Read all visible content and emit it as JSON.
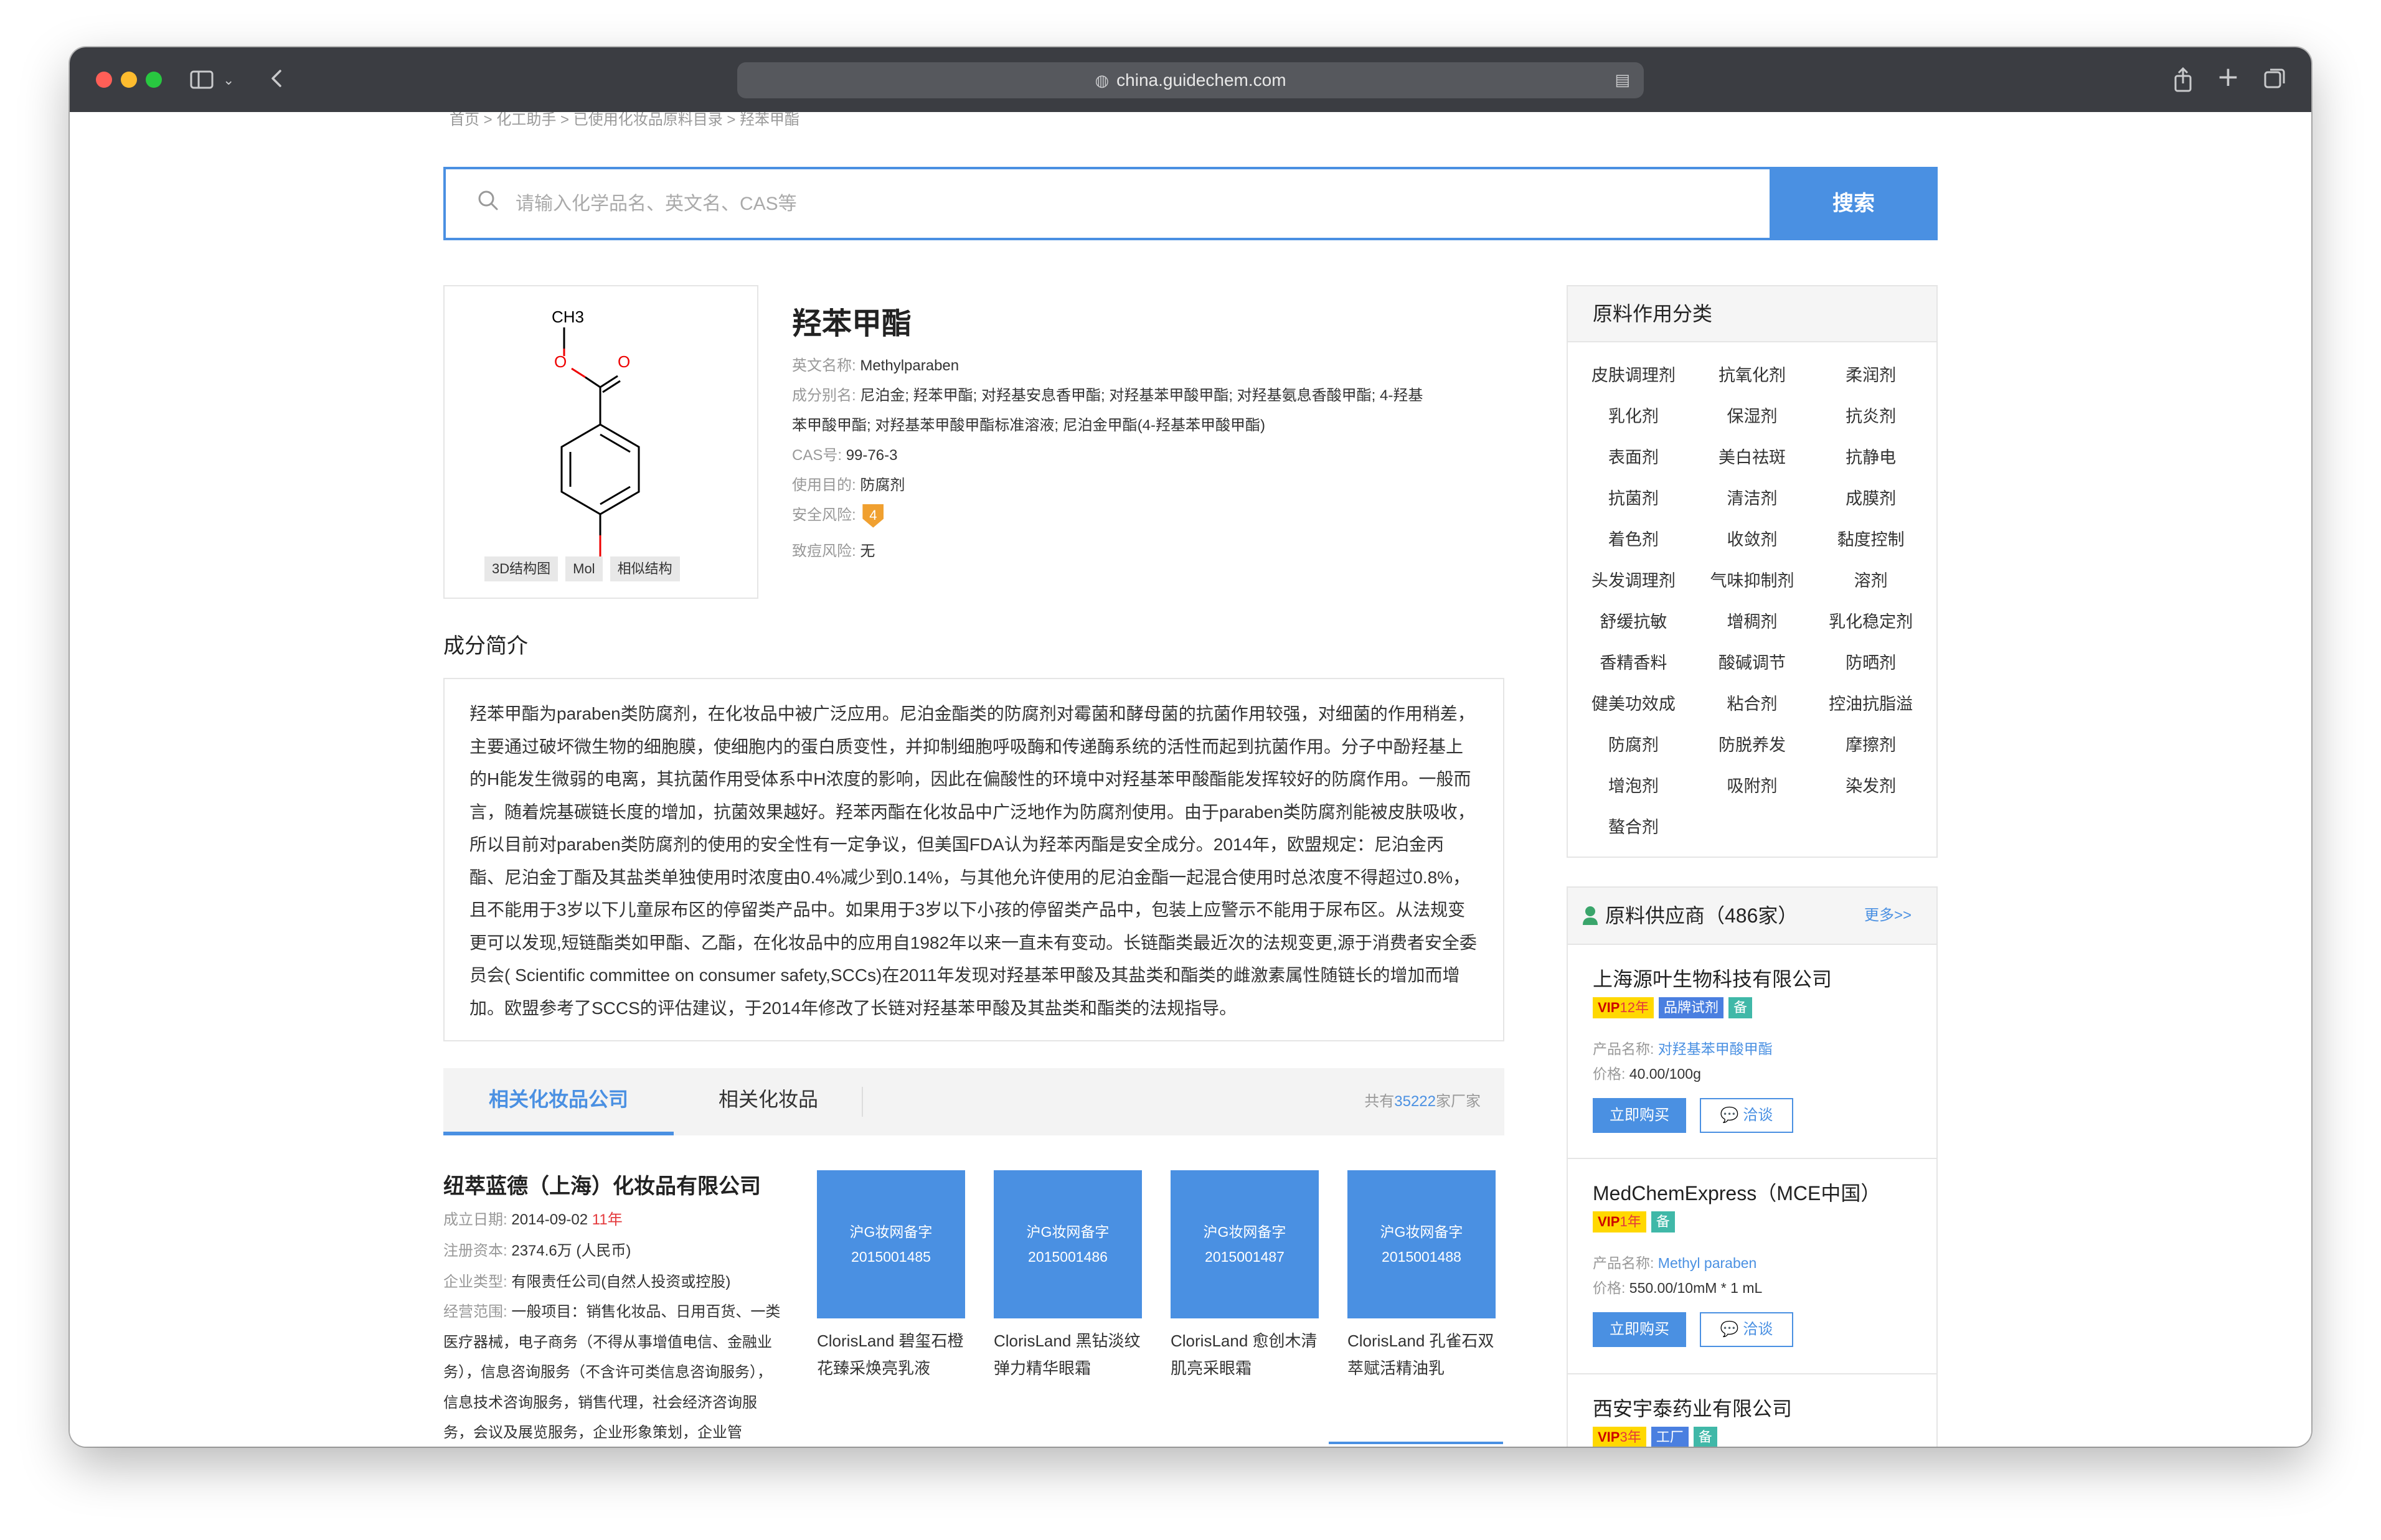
{
  "browser": {
    "url": "china.guidechem.com"
  },
  "breadcrumb": "首页 >   化工助手 >   已使用化妆品原料目录 > 羟苯甲酯",
  "search": {
    "placeholder": "请输入化学品名、英文名、CAS等",
    "button": "搜索"
  },
  "structure": {
    "methyl_label": "CH3",
    "tabs": [
      "3D结构图",
      "Mol",
      "相似结构"
    ]
  },
  "compound": {
    "title": "羟苯甲酯",
    "en_label": "英文名称:",
    "en_value": "Methylparaben",
    "alias_label": "成分别名:",
    "alias_line1": "尼泊金; 羟苯甲酯; 对羟基安息香甲酯; 对羟基苯甲酸甲酯; 对羟基氨息香酸甲酯; 4-羟基",
    "alias_line2": "苯甲酸甲酯; 对羟基苯甲酸甲酯标准溶液; 尼泊金甲酯(4-羟基苯甲酸甲酯)",
    "cas_label": "CAS号:",
    "cas_value": "99-76-3",
    "purpose_label": "使用目的:",
    "purpose_value": "防腐剂",
    "risk_label": "安全风险:",
    "risk_value": "4",
    "acne_label": "致痘风险:",
    "acne_value": "无"
  },
  "intro": {
    "title": "成分简介",
    "text": "羟苯甲酯为paraben类防腐剂，在化妆品中被广泛应用。尼泊金酯类的防腐剂对霉菌和酵母菌的抗菌作用较强，对细菌的作用稍差，主要通过破坏微生物的细胞膜，使细胞内的蛋白质变性，并抑制细胞呼吸酶和传递酶系统的活性而起到抗菌作用。分子中酚羟基上的H能发生微弱的电离，其抗菌作用受体系中H浓度的影响，因此在偏酸性的环境中对羟基苯甲酸酯能发挥较好的防腐作用。一般而言，随着烷基碳链长度的增加，抗菌效果越好。羟苯丙酯在化妆品中广泛地作为防腐剂使用。由于paraben类防腐剂能被皮肤吸收，所以目前对paraben类防腐剂的使用的安全性有一定争议，但美国FDA认为羟苯丙酯是安全成分。2014年，欧盟规定：尼泊金丙酯、尼泊金丁酯及其盐类单独使用时浓度由0.4%减少到0.14%，与其他允许使用的尼泊金酯一起混合使用时总浓度不得超过0.8%，且不能用于3岁以下儿童尿布区的停留类产品中。如果用于3岁以下小孩的停留类产品中，包装上应警示不能用于尿布区。从法规变更可以发现,短链酯类如甲酯、乙酯，在化妆品中的应用自1982年以来一直未有变动。长链酯类最近次的法规变更,源于消费者安全委员会( Scientific committee on consumer safety,SCCs)在2011年发现对羟基苯甲酸及其盐类和酯类的雌激素属性随链长的增加而增加。欧盟参考了SCCS的评估建议，于2014年修改了长链对羟基苯甲酸及其盐类和酯类的法规指导。"
  },
  "tabs": {
    "active": "相关化妆品公司",
    "other": "相关化妆品",
    "count_prefix": "共有",
    "count_num": "35222",
    "count_suffix": "家厂家"
  },
  "company": {
    "name": "纽萃蓝德（上海）化妆品有限公司",
    "founded_label": "成立日期:",
    "founded_value": "2014-09-02",
    "founded_years": "11年",
    "capital_label": "注册资本:",
    "capital_value": "2374.6万 (人民币)",
    "type_label": "企业类型:",
    "type_value": "有限责任公司(自然人投资或控股)",
    "scope_label": "经营范围:",
    "scope_value": "一般项目：销售化妆品、日用百货、一类医疗器械，电子商务（不得从事增值电信、金融业务），信息咨询服务（不含许可类信息咨询服务），信息技术咨询服务，销售代理，社会经济咨询服务，会议及展览服务，企业形象策划，企业管"
  },
  "products": [
    {
      "img_line1": "沪G妆网备字",
      "img_line2": "2015001485",
      "name": "ClorisLand 碧玺石橙花臻采焕亮乳液"
    },
    {
      "img_line1": "沪G妆网备字",
      "img_line2": "2015001486",
      "name": "ClorisLand 黑钻淡纹弹力精华眼霜"
    },
    {
      "img_line1": "沪G妆网备字",
      "img_line2": "2015001487",
      "name": "ClorisLand 愈创木清肌亮采眼霜"
    },
    {
      "img_line1": "沪G妆网备字",
      "img_line2": "2015001488",
      "name": "ClorisLand 孔雀石双萃赋活精油乳"
    }
  ],
  "categories": {
    "title": "原料作用分类",
    "items": [
      "皮肤调理剂",
      "抗氧化剂",
      "柔润剂",
      "乳化剂",
      "保湿剂",
      "抗炎剂",
      "表面剂",
      "美白祛斑",
      "抗静电",
      "抗菌剂",
      "清洁剂",
      "成膜剂",
      "着色剂",
      "收敛剂",
      "黏度控制",
      "头发调理剂",
      "气味抑制剂",
      "溶剂",
      "舒缓抗敏",
      "增稠剂",
      "乳化稳定剂",
      "香精香料",
      "酸碱调节",
      "防晒剂",
      "健美功效成",
      "粘合剂",
      "控油抗脂溢",
      "防腐剂",
      "防脱养发",
      "摩擦剂",
      "增泡剂",
      "吸附剂",
      "染发剂",
      "螯合剂"
    ]
  },
  "suppliers": {
    "title": "原料供应商（486家）",
    "more": "更多>>",
    "product_label": "产品名称:",
    "price_label": "价格:",
    "buy": "立即购买",
    "chat": "洽谈",
    "items": [
      {
        "name": "上海源叶生物科技有限公司",
        "vip": "VIP",
        "years": "12年",
        "brand": "品牌试剂",
        "bei": "备",
        "product": "对羟基苯甲酸甲酯",
        "price": "40.00/100g"
      },
      {
        "name": "MedChemExpress（MCE中国）",
        "vip": "VIP",
        "years": "1年",
        "bei": "备",
        "product": "Methyl paraben",
        "price": "550.00/10mM * 1 mL"
      },
      {
        "name": "西安宇泰药业有限公司",
        "vip": "VIP",
        "years": "3年",
        "factory": "工厂",
        "bei": "备"
      }
    ]
  },
  "colors": {
    "accent": "#4a90e2",
    "titlebar": "#3b3d42",
    "risk": "#f0a030",
    "vip": "#ffd800",
    "red": "#e4393c"
  }
}
